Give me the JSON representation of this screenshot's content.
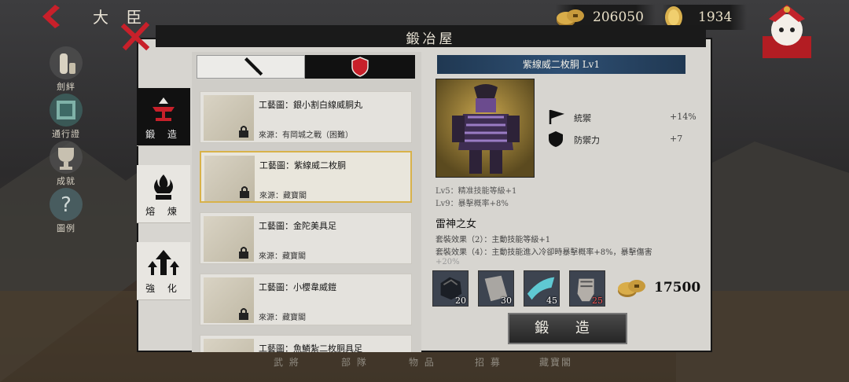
{
  "header": {
    "title": "大 臣",
    "coins": "206050",
    "gold": "1934"
  },
  "left_nav": [
    {
      "label": "劍絆",
      "icon": "sake-bottle-icon"
    },
    {
      "label": "通行證",
      "icon": "pass-ticket-icon"
    },
    {
      "label": "成就",
      "icon": "trophy-icon"
    },
    {
      "label": "圖例",
      "icon": "question-icon"
    }
  ],
  "panel": {
    "title": "鍛冶屋"
  },
  "side_tabs": [
    {
      "label": "鍛 造",
      "icon": "anvil-icon"
    },
    {
      "label": "熔 煉",
      "icon": "furnace-icon"
    },
    {
      "label": "強 化",
      "icon": "upgrade-arrows-icon"
    }
  ],
  "filters": [
    {
      "icon": "sword-icon"
    },
    {
      "icon": "shield-icon"
    }
  ],
  "recipes": [
    {
      "name": "工藝圖：銀小割白線威胴丸",
      "source": "來源：有岡城之戰（困難）"
    },
    {
      "name": "工藝圖：紫線威二枚胴",
      "source": "來源：藏寶閣"
    },
    {
      "name": "工藝圖：金陀美具足",
      "source": "來源：藏寶閣"
    },
    {
      "name": "工藝圖：小櫻韋威鎧",
      "source": "來源：藏寶閣"
    },
    {
      "name": "工藝圖：魚鱗紮二枚胴具足",
      "source": ""
    }
  ],
  "detail": {
    "title": "紫線威二枚胴 Lv1",
    "stats": [
      {
        "label": "統禦",
        "value": "+14%"
      },
      {
        "label": "防禦力",
        "value": "+7"
      }
    ],
    "level_bonus": [
      "Lv5：精准技能等級+1",
      "Lv9：暴擊概率+8%"
    ],
    "set_name": "雷神之女",
    "set_effects": [
      "套裝效果（2）：主動技能等級+1",
      "套裝效果（4）：主動技能進入冷卻時暴擊概率+8%，暴擊傷害"
    ],
    "set_effect_cut": "+20%",
    "materials": [
      {
        "count": "20",
        "icon": "ore-icon"
      },
      {
        "count": "30",
        "icon": "cloth-icon"
      },
      {
        "count": "45",
        "icon": "silk-icon"
      },
      {
        "count": "25",
        "icon": "gauntlet-icon"
      }
    ],
    "cost": "17500",
    "forge_label": "鍛 造"
  },
  "bottom_nav": [
    "武 將",
    "部 隊",
    "物 品",
    "招 募",
    "藏寶閣"
  ],
  "colors": {
    "accent_red": "#c8202a",
    "title_blue": "#2e4f73",
    "selected_gold": "#d8b24a"
  }
}
